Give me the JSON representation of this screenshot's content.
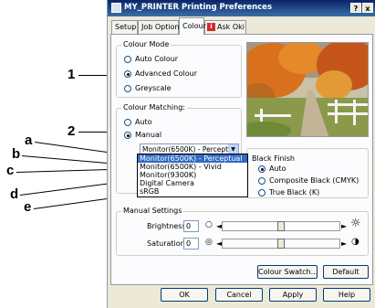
{
  "callouts": {
    "c1": "1",
    "c2": "2",
    "ca": "a",
    "cb": "b",
    "cc": "c",
    "cd": "d",
    "ce": "e"
  },
  "window": {
    "title": "MY_PRINTER Printing Preferences",
    "help_btn": "?",
    "close_btn": "x"
  },
  "tabs": [
    "Setup",
    "Job Options",
    "Colour",
    "Ask Oki"
  ],
  "colour_mode": {
    "label": "Colour Mode",
    "options": [
      "Auto Colour",
      "Advanced Colour",
      "Greyscale"
    ],
    "selected": "Advanced Colour"
  },
  "colour_matching": {
    "label": "Colour Matching:",
    "options": [
      "Auto",
      "Manual"
    ],
    "selected": "Manual",
    "dropdown_value": "Monitor(6500K) - Perceptual",
    "dropdown_items": [
      "Monitor(6500K) - Perceptual",
      "Monitor(6500K) - Vivid",
      "Monitor(9300K)",
      "Digital Camera",
      "sRGB"
    ]
  },
  "black_finish": {
    "label": "Black Finish",
    "options": [
      "Auto",
      "Composite Black (CMYK)",
      "True Black (K)"
    ],
    "selected": "Auto"
  },
  "manual_settings": {
    "label": "Manual Settings",
    "brightness_label": "Brightness:",
    "brightness_value": "0",
    "saturation_label": "Saturation:",
    "saturation_value": "0",
    "brightness_level": 0.5,
    "saturation_level": 0.5
  },
  "buttons": {
    "colour_swatch": "Colour Swatch...",
    "default": "Default",
    "ok": "OK",
    "cancel": "Cancel",
    "apply": "Apply",
    "help": "Help"
  },
  "icons": {
    "ask_oki": "info-icon",
    "brightness": "sun-icon",
    "saturation": "contrast-icon"
  },
  "colors": {
    "title_bar": "#0a246a",
    "selection": "#316ac5",
    "dialog_bg": "#ece9d8",
    "ask_oki_icon": "#d22a2a"
  }
}
